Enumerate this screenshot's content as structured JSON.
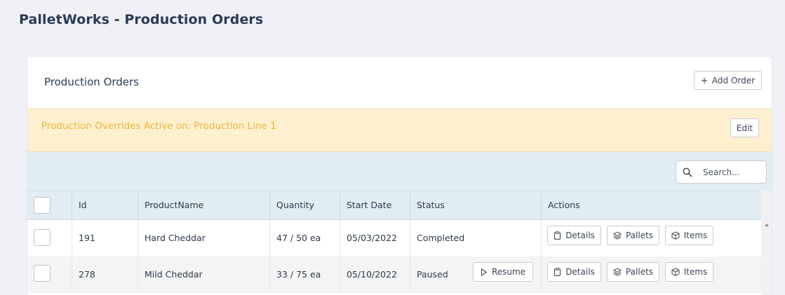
{
  "app": {
    "title": "PalletWorks - Production Orders"
  },
  "card": {
    "title": "Production Orders",
    "add_button": "Add Order"
  },
  "banner": {
    "text": "Production Overrides Active on: Production Line 1",
    "edit_button": "Edit"
  },
  "search": {
    "placeholder": "Search..."
  },
  "table": {
    "columns": [
      "Id",
      "ProductName",
      "Quantity",
      "Start Date",
      "Status",
      "Actions"
    ],
    "rows": [
      {
        "id": "191",
        "product": "Hard Cheddar",
        "quantity": "47 / 50 ea",
        "start_date": "05/03/2022",
        "status": "Completed",
        "status_action": ""
      },
      {
        "id": "278",
        "product": "Mild Cheddar",
        "quantity": "33 / 75 ea",
        "start_date": "05/10/2022",
        "status": "Paused",
        "status_action": "Resume"
      }
    ],
    "actions": {
      "details": "Details",
      "pallets": "Pallets",
      "items": "Items"
    }
  },
  "icons": {
    "add": "plus-icon",
    "search": "search-icon",
    "details": "clipboard-icon",
    "pallets": "layers-icon",
    "items": "box-icon",
    "resume": "play-icon"
  }
}
